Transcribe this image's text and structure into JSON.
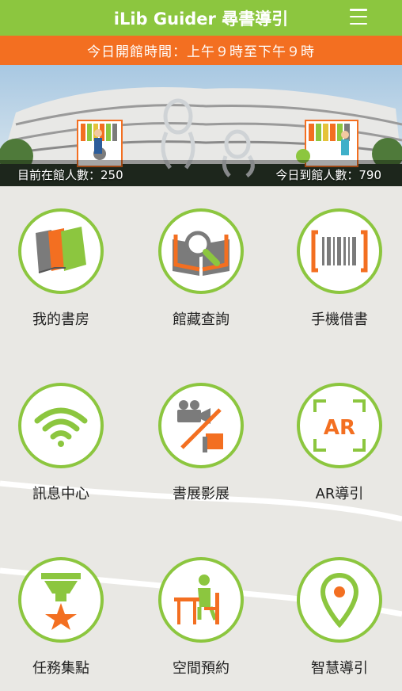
{
  "header": {
    "title": "iLib Guider 尋書導引",
    "menu_icon": "hamburger-menu-icon"
  },
  "notice": {
    "hours": "今日開館時間：上午９時至下午９時"
  },
  "banner": {
    "current_visitors_label": "目前在館人數：250",
    "today_visitors_label": "今日到館人數：790"
  },
  "colors": {
    "green": "#8cc63f",
    "orange": "#f36f21",
    "grey": "#7b7b7b"
  },
  "tiles": [
    {
      "label": "我的書房",
      "icon": "books-icon"
    },
    {
      "label": "館藏查詢",
      "icon": "book-search-icon"
    },
    {
      "label": "手機借書",
      "icon": "barcode-icon"
    },
    {
      "label": "訊息中心",
      "icon": "wifi-icon"
    },
    {
      "label": "書展影展",
      "icon": "film-book-icon"
    },
    {
      "label": "AR導引",
      "icon": "ar-icon"
    },
    {
      "label": "任務集點",
      "icon": "medal-icon"
    },
    {
      "label": "空間預約",
      "icon": "seat-reservation-icon"
    },
    {
      "label": "智慧導引",
      "icon": "location-pin-icon"
    }
  ]
}
